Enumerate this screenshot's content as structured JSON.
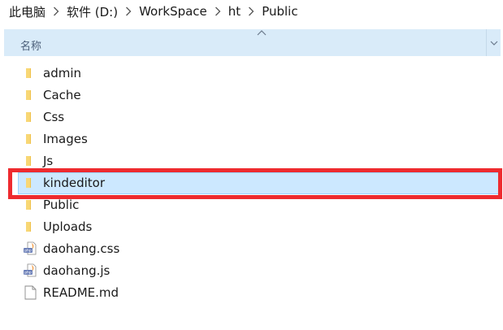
{
  "breadcrumb": [
    "此电脑",
    "软件 (D:)",
    "WorkSpace",
    "ht",
    "Public"
  ],
  "header": {
    "name_column": "名称"
  },
  "files": [
    {
      "name": "admin",
      "type": "folder",
      "icon": "folder-icon"
    },
    {
      "name": "Cache",
      "type": "folder",
      "icon": "folder-icon"
    },
    {
      "name": "Css",
      "type": "folder",
      "icon": "folder-icon"
    },
    {
      "name": "Images",
      "type": "folder",
      "icon": "folder-icon"
    },
    {
      "name": "Js",
      "type": "folder",
      "icon": "folder-icon"
    },
    {
      "name": "kindeditor",
      "type": "folder",
      "icon": "folder-icon",
      "selected": true
    },
    {
      "name": "Public",
      "type": "folder",
      "icon": "folder-icon"
    },
    {
      "name": "Uploads",
      "type": "folder",
      "icon": "folder-icon"
    },
    {
      "name": "daohang.css",
      "type": "file",
      "icon": "php-file-icon"
    },
    {
      "name": "daohang.js",
      "type": "file",
      "icon": "php-file-icon"
    },
    {
      "name": "README.md",
      "type": "file",
      "icon": "blank-file-icon"
    }
  ],
  "colors": {
    "header_bg": "#d9ebf9",
    "selected_bg": "#cce8ff",
    "selected_border": "#99d1ff",
    "highlight": "#ee2b2f",
    "folder": "#f8d775"
  }
}
